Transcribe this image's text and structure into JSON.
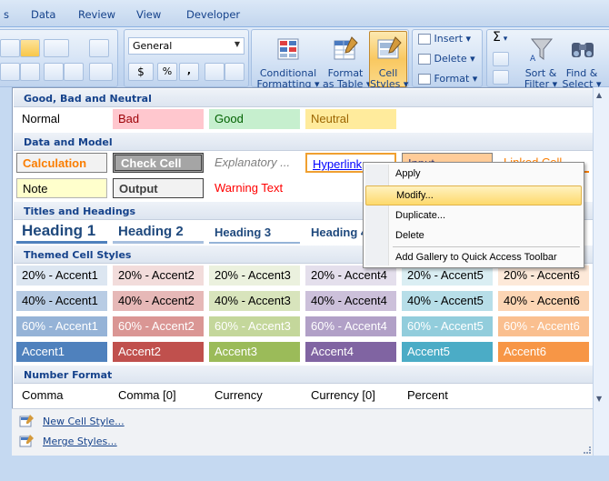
{
  "tabs": [
    "Data",
    "Review",
    "View",
    "Developer"
  ],
  "ribbon": {
    "number_format": "General",
    "currency": "$",
    "percent": "%",
    "comma": ",",
    "cond_format": [
      "Conditional",
      "Formatting"
    ],
    "format_table": [
      "Format",
      "as Table"
    ],
    "cell_styles": [
      "Cell",
      "Styles"
    ],
    "insert": "Insert",
    "delete": "Delete",
    "format": "Format",
    "sort_filter": [
      "Sort &",
      "Filter"
    ],
    "find_select": [
      "Find &",
      "Select"
    ],
    "sigma": "Σ"
  },
  "sections": {
    "good_bad": "Good, Bad and Neutral",
    "data_model": "Data and Model",
    "titles": "Titles and Headings",
    "themed": "Themed Cell Styles",
    "number": "Number Format"
  },
  "good_bad": [
    "Normal",
    "Bad",
    "Good",
    "Neutral"
  ],
  "data_model_row1": [
    "Calculation",
    "Check Cell",
    "Explanatory ...",
    "Hyperlink",
    "Input",
    "Linked Cell"
  ],
  "data_model_row2": [
    "Note",
    "Output",
    "Warning Text"
  ],
  "headings": [
    "Heading 1",
    "Heading 2",
    "Heading 3",
    "Heading 4"
  ],
  "accent20": [
    "20% - Accent1",
    "20% - Accent2",
    "20% - Accent3",
    "20% - Accent4",
    "20% - Accent5",
    "20% - Accent6"
  ],
  "accent40": [
    "40% - Accent1",
    "40% - Accent2",
    "40% - Accent3",
    "40% - Accent4",
    "40% - Accent5",
    "40% - Accent6"
  ],
  "accent60": [
    "60% - Accent1",
    "60% - Accent2",
    "60% - Accent3",
    "60% - Accent4",
    "60% - Accent5",
    "60% - Accent6"
  ],
  "accent": [
    "Accent1",
    "Accent2",
    "Accent3",
    "Accent4",
    "Accent5",
    "Accent6"
  ],
  "number_styles": [
    "Comma",
    "Comma [0]",
    "Currency",
    "Currency [0]",
    "Percent"
  ],
  "footer": {
    "new_style": "New Cell Style...",
    "merge": "Merge Styles..."
  },
  "context_menu": {
    "apply": "Apply",
    "modify": "Modify...",
    "duplicate": "Duplicate...",
    "delete": "Delete",
    "add_qat": "Add Gallery to Quick Access Toolbar"
  },
  "colors": {
    "accent1": "#4f81bd",
    "accent2": "#c0504d",
    "accent3": "#9bbb59",
    "accent4": "#8064a2",
    "accent5": "#4bacc6",
    "accent6": "#f79646"
  }
}
